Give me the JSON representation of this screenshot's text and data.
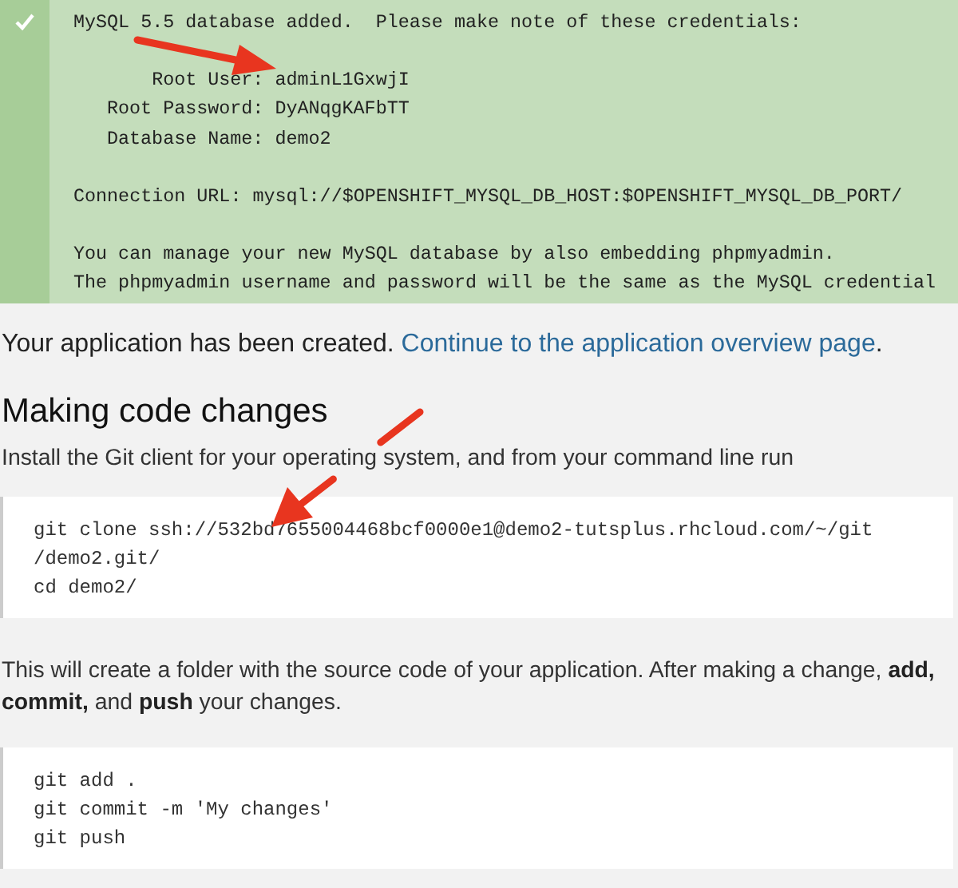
{
  "alert": {
    "heading": "MySQL 5.5 database added.  Please make note of these credentials:",
    "credentials": [
      {
        "label": "Root User:",
        "value": "adminL1GxwjI"
      },
      {
        "label": "Root Password:",
        "value": "DyANqgKAFbTT"
      },
      {
        "label": "Database Name:",
        "value": "demo2"
      }
    ],
    "connection": "Connection URL: mysql://$OPENSHIFT_MYSQL_DB_HOST:$OPENSHIFT_MYSQL_DB_PORT/",
    "notes": [
      "You can manage your new MySQL database by also embedding phpmyadmin.",
      "The phpmyadmin username and password will be the same as the MySQL credential"
    ]
  },
  "created": {
    "text": "Your application has been created.",
    "link": "Continue to the application overview page",
    "after": "."
  },
  "section": {
    "heading": "Making code changes",
    "intro": "Install the Git client for your operating system, and from your command line run",
    "clone_code": [
      "git clone ssh://532bd7655004468bcf0000e1@demo2-tutsplus.rhcloud.com/~/git",
      "/demo2.git/",
      "cd demo2/"
    ],
    "explanation": "This will create a folder with the source code of your application. After making a change, **add,** **commit,** and **push** your changes.",
    "commit_code": [
      "git add .",
      "git commit -m 'My changes'",
      "git push"
    ]
  }
}
